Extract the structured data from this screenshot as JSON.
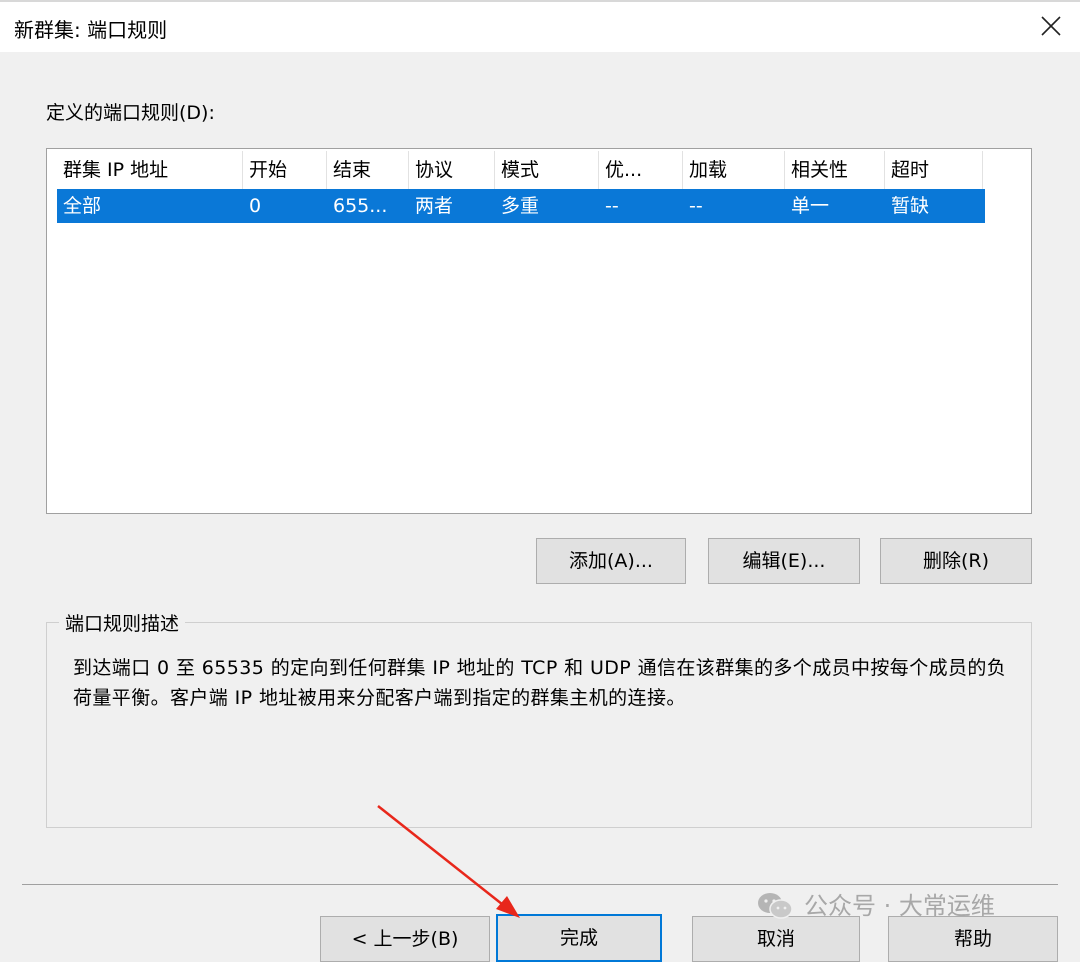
{
  "window": {
    "title": "新群集: 端口规则",
    "close_icon": "close-icon"
  },
  "port_rules": {
    "label": "定义的端口规则(D):",
    "columns": [
      "群集 IP 地址",
      "开始",
      "结束",
      "协议",
      "模式",
      "优...",
      "加载",
      "相关性",
      "超时"
    ],
    "rows": [
      [
        "全部",
        "0",
        "655...",
        "两者",
        "多重",
        "--",
        "--",
        "单一",
        "暂缺"
      ]
    ],
    "selected_row_color": "#0a78d7"
  },
  "actions": {
    "add": "添加(A)...",
    "edit": "编辑(E)...",
    "delete": "删除(R)"
  },
  "description": {
    "title": "端口规则描述",
    "text": "到达端口 0 至 65535 的定向到任何群集 IP 地址的 TCP 和 UDP 通信在该群集的多个成员中按每个成员的负荷量平衡。客户端 IP 地址被用来分配客户端到指定的群集主机的连接。"
  },
  "footer": {
    "back": "< 上一步(B)",
    "finish": "完成",
    "cancel": "取消",
    "help": "帮助"
  },
  "watermark": {
    "text": "公众号 · 大常运维",
    "icon": "wechat-icon"
  },
  "annotation": {
    "arrow_color": "#e8271b"
  }
}
